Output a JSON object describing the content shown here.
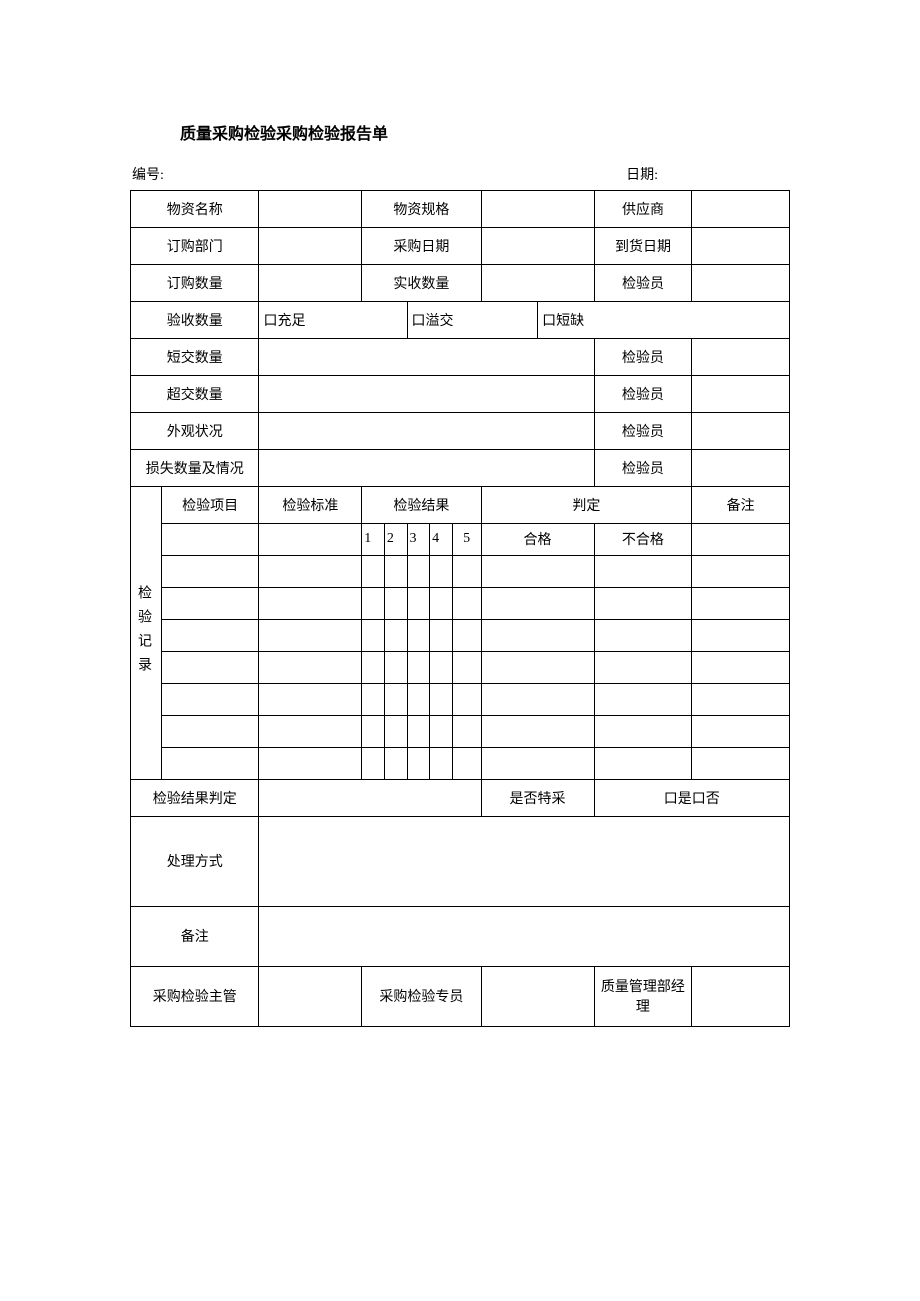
{
  "title": "质量采购检验采购检验报告单",
  "meta": {
    "number_label": "编号:",
    "date_label": "日期:"
  },
  "labels": {
    "material_name": "物资名称",
    "material_spec": "物资规格",
    "supplier": "供应商",
    "order_dept": "订购部门",
    "purchase_date": "采购日期",
    "arrival_date": "到货日期",
    "order_qty": "订购数量",
    "received_qty": "实收数量",
    "inspector": "检验员",
    "accept_qty": "验收数量",
    "sufficient": "口充足",
    "overflow": "口溢交",
    "shortage": "口短缺",
    "short_qty": "短交数量",
    "over_qty": "超交数量",
    "appearance": "外观状况",
    "loss_qty": "损失数量及情况",
    "record": "检验记录",
    "check_item": "检验项目",
    "check_std": "检验标准",
    "check_result": "检验结果",
    "judge": "判定",
    "remark": "备注",
    "c1": "1",
    "c2": "2",
    "c3": "3",
    "c4": "4",
    "c5": "5",
    "pass": "合格",
    "fail": "不合格",
    "result_judge": "检验结果判定",
    "special": "是否特采",
    "yes_no": "口是口否",
    "handle": "处理方式",
    "remark2": "备注",
    "supervisor": "采购检验主管",
    "specialist": "采购检验专员",
    "manager": "质量管理部经理"
  }
}
